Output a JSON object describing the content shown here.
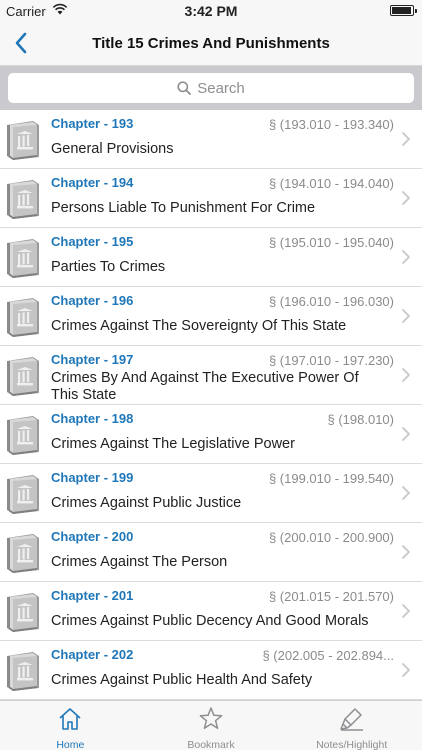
{
  "status_bar": {
    "carrier": "Carrier",
    "time": "3:42 PM"
  },
  "nav": {
    "title": "Title 15 Crimes And Punishments"
  },
  "search": {
    "placeholder": "Search"
  },
  "colors": {
    "accent": "#1f77b8",
    "chevron": "#c7c7cc"
  },
  "chapters": [
    {
      "chapter": "Chapter - 193",
      "range": "§ (193.010 - 193.340)",
      "name": "General Provisions"
    },
    {
      "chapter": "Chapter - 194",
      "range": "§ (194.010 - 194.040)",
      "name": "Persons Liable To Punishment For Crime"
    },
    {
      "chapter": "Chapter - 195",
      "range": "§ (195.010 - 195.040)",
      "name": "Parties To Crimes"
    },
    {
      "chapter": "Chapter - 196",
      "range": "§ (196.010 - 196.030)",
      "name": "Crimes Against The Sovereignty Of This State"
    },
    {
      "chapter": "Chapter - 197",
      "range": "§ (197.010 - 197.230)",
      "name": "Crimes By And Against The Executive Power Of This State"
    },
    {
      "chapter": "Chapter - 198",
      "range": "§ (198.010)",
      "name": "Crimes Against The Legislative Power"
    },
    {
      "chapter": "Chapter - 199",
      "range": "§ (199.010 - 199.540)",
      "name": "Crimes Against Public Justice"
    },
    {
      "chapter": "Chapter - 200",
      "range": "§ (200.010 - 200.900)",
      "name": "Crimes Against The Person"
    },
    {
      "chapter": "Chapter - 201",
      "range": "§ (201.015 - 201.570)",
      "name": "Crimes Against Public Decency And Good Morals"
    },
    {
      "chapter": "Chapter - 202",
      "range": "§ (202.005 - 202.894...",
      "name": "Crimes Against Public Health And Safety"
    }
  ],
  "tabs": [
    {
      "label": "Home",
      "icon": "home-icon",
      "active": true
    },
    {
      "label": "Bookmark",
      "icon": "star-icon",
      "active": false
    },
    {
      "label": "Notes/Highlight",
      "icon": "highlighter-icon",
      "active": false
    }
  ]
}
